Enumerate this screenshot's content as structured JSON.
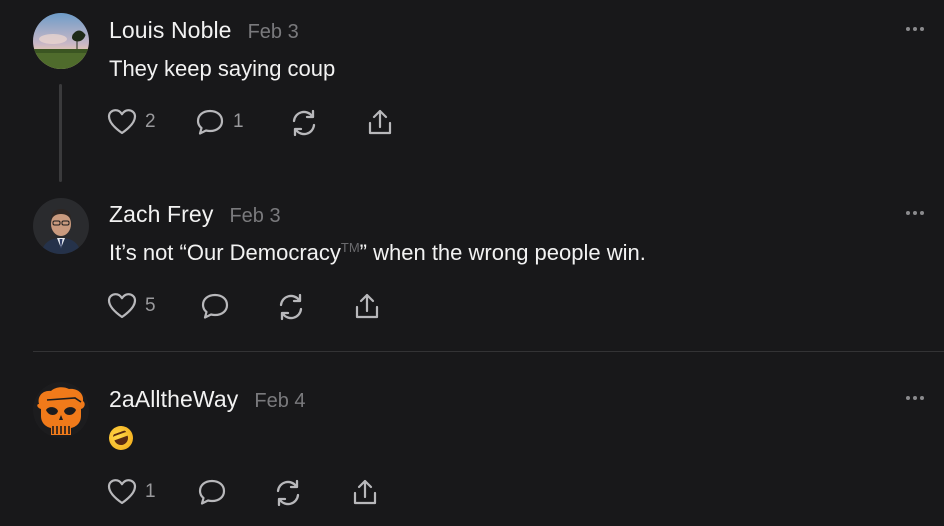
{
  "posts": [
    {
      "author": "Louis Noble",
      "date": "Feb 3",
      "text": "They keep saying coup",
      "likes": "2",
      "replies": "1",
      "avatar_icon": "landscape-avatar"
    },
    {
      "author": "Zach Frey",
      "date": "Feb 3",
      "text_before": "It’s not “Our Democracy",
      "trademark": "TM",
      "text_after": "” when the wrong people win.",
      "likes": "5",
      "avatar_icon": "person-avatar"
    },
    {
      "author": "2aAlltheWay",
      "date": "Feb 4",
      "emoji_icon": "rolling-on-floor-laughing-emoji",
      "likes": "1",
      "avatar_icon": "orange-skull-avatar"
    }
  ],
  "colors": {
    "background": "#18181a",
    "text": "#f2f2f2",
    "muted": "#7a7a7d",
    "skull": "#f07a1a"
  }
}
